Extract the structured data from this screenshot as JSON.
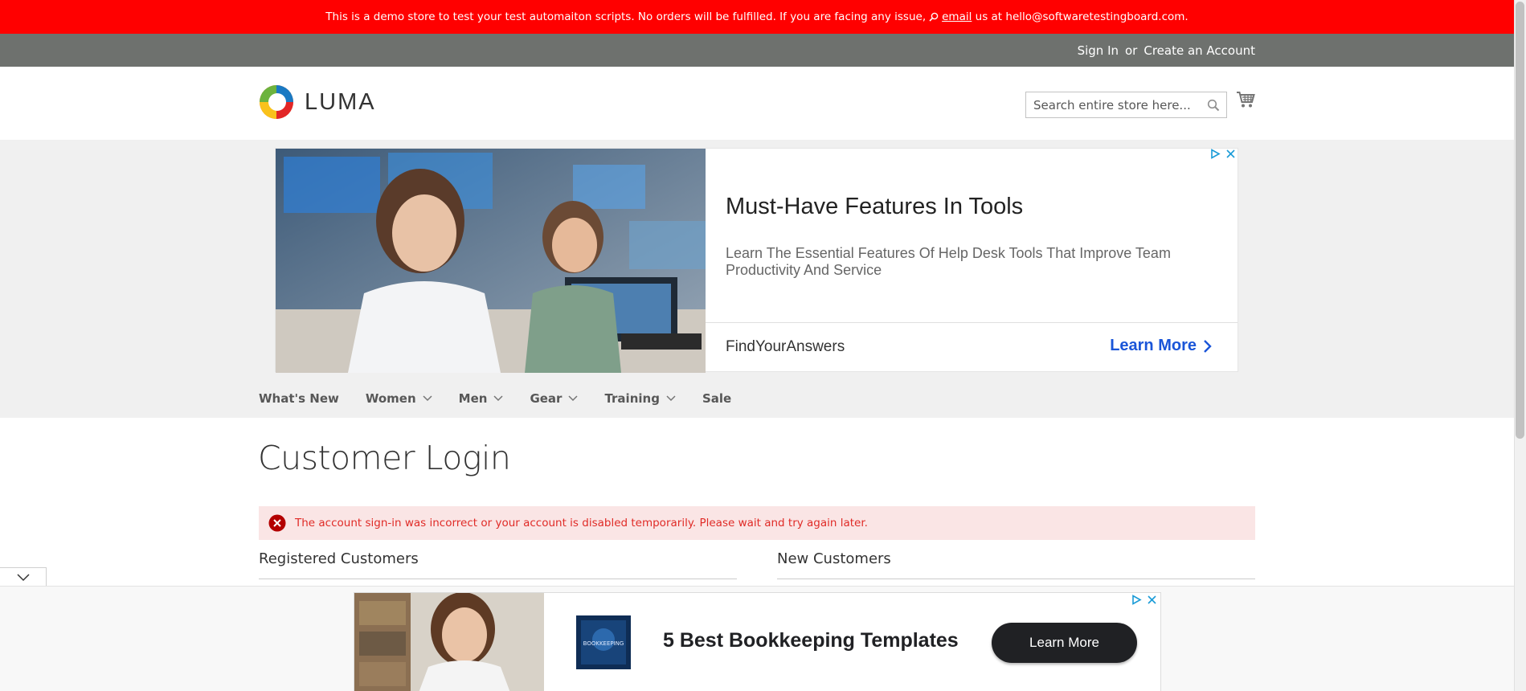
{
  "banner": {
    "text_before": "This is a demo store to test your test automaiton scripts. No orders will be fulfilled. If you are facing any issue,",
    "email_link": "email",
    "text_after": "us at hello@softwaretestingboard.com."
  },
  "top_links": {
    "sign_in": "Sign In",
    "or": "or",
    "create_account": "Create an Account"
  },
  "header": {
    "logo_text": "LUMA",
    "search_placeholder": "Search entire store here..."
  },
  "top_ad": {
    "title": "Must-Have Features In Tools",
    "description": "Learn The Essential Features Of Help Desk Tools That Improve Team Productivity And Service",
    "brand": "FindYourAnswers",
    "cta": "Learn More"
  },
  "nav": {
    "items": [
      {
        "label": "What's New",
        "has_menu": false
      },
      {
        "label": "Women",
        "has_menu": true
      },
      {
        "label": "Men",
        "has_menu": true
      },
      {
        "label": "Gear",
        "has_menu": true
      },
      {
        "label": "Training",
        "has_menu": true
      },
      {
        "label": "Sale",
        "has_menu": false
      }
    ]
  },
  "main": {
    "page_title": "Customer Login",
    "error_message": "The account sign-in was incorrect or your account is disabled temporarily. Please wait and try again later.",
    "registered_title": "Registered Customers",
    "new_title": "New Customers"
  },
  "bottom_ad": {
    "thumb_label": "BOOKKEEPING",
    "title": "5 Best Bookkeeping Templates",
    "cta": "Learn More"
  },
  "colors": {
    "banner_bg": "#ff0000",
    "top_bar_bg": "#6e716e",
    "error_bg": "#fae5e5",
    "error_text": "#e02b27",
    "ad_link": "#1a55d8"
  }
}
